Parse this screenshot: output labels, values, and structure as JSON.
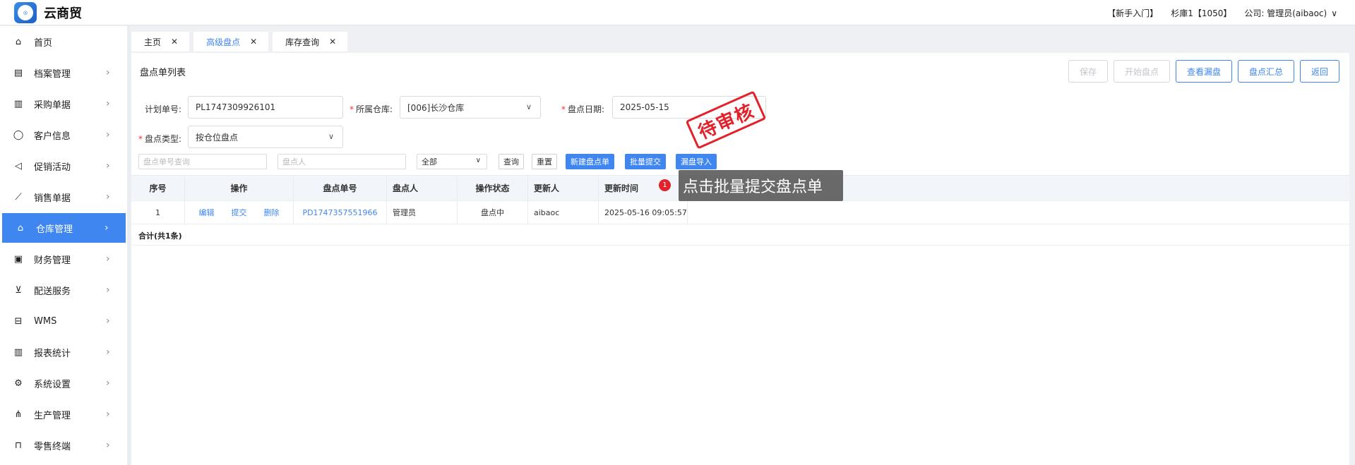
{
  "app": {
    "title": "云商贸"
  },
  "topbar": {
    "guide": "【新手入门】",
    "store": "杉庫1【1050】",
    "company": "公司: 管理员(aibaoc)"
  },
  "sidebar": {
    "items": [
      {
        "label": "首页",
        "icon": "home-icon"
      },
      {
        "label": "档案管理",
        "icon": "archive-icon"
      },
      {
        "label": "采购单据",
        "icon": "document-icon"
      },
      {
        "label": "客户信息",
        "icon": "user-icon"
      },
      {
        "label": "促销活动",
        "icon": "megaphone-icon"
      },
      {
        "label": "销售单据",
        "icon": "trend-icon"
      },
      {
        "label": "仓库管理",
        "icon": "warehouse-icon",
        "active": true
      },
      {
        "label": "财务管理",
        "icon": "finance-icon"
      },
      {
        "label": "配送服务",
        "icon": "cart-icon"
      },
      {
        "label": "WMS",
        "icon": "truck-icon"
      },
      {
        "label": "报表统计",
        "icon": "bar-chart-icon"
      },
      {
        "label": "系统设置",
        "icon": "gear-icon"
      },
      {
        "label": "生产管理",
        "icon": "network-icon"
      },
      {
        "label": "零售终端",
        "icon": "bag-icon"
      }
    ]
  },
  "tabs": [
    {
      "label": "主页"
    },
    {
      "label": "高级盘点",
      "active": true
    },
    {
      "label": "库存查询"
    }
  ],
  "page": {
    "title": "盘点单列表",
    "buttons": {
      "save": "保存",
      "start": "开始盘点",
      "view_missing": "查看漏盘",
      "summary": "盘点汇总",
      "back": "返回"
    }
  },
  "form": {
    "plan_no_label": "计划单号:",
    "plan_no_value": "PL1747309926101",
    "warehouse_label": "所属仓库:",
    "warehouse_value": "[006]长沙仓库",
    "date_label": "盘点日期:",
    "date_value": "2025-05-15",
    "type_label": "盘点类型:",
    "type_value": "按仓位盘点"
  },
  "stamp": "待审核",
  "filters": {
    "order_placeholder": "盘点单号查询",
    "person_placeholder": "盘点人",
    "status_value": "全部",
    "query": "查询",
    "reset": "重置",
    "new_order": "新建盘点单",
    "batch_submit": "批量提交",
    "missing_import": "漏盘导入"
  },
  "table": {
    "headers": [
      "序号",
      "操作",
      "盘点单号",
      "盘点人",
      "操作状态",
      "更新人",
      "更新时间"
    ],
    "rows": [
      {
        "seq": "1",
        "ops": [
          "编辑",
          "提交",
          "删除"
        ],
        "order_no": "PD1747357551966",
        "person": "管理员",
        "status": "盘点中",
        "updater": "aibaoc",
        "time": "2025-05-16 09:05:57"
      }
    ],
    "summary": "合计(共1条)"
  },
  "tooltip": {
    "badge": "1",
    "text": "点击批量提交盘点单"
  }
}
